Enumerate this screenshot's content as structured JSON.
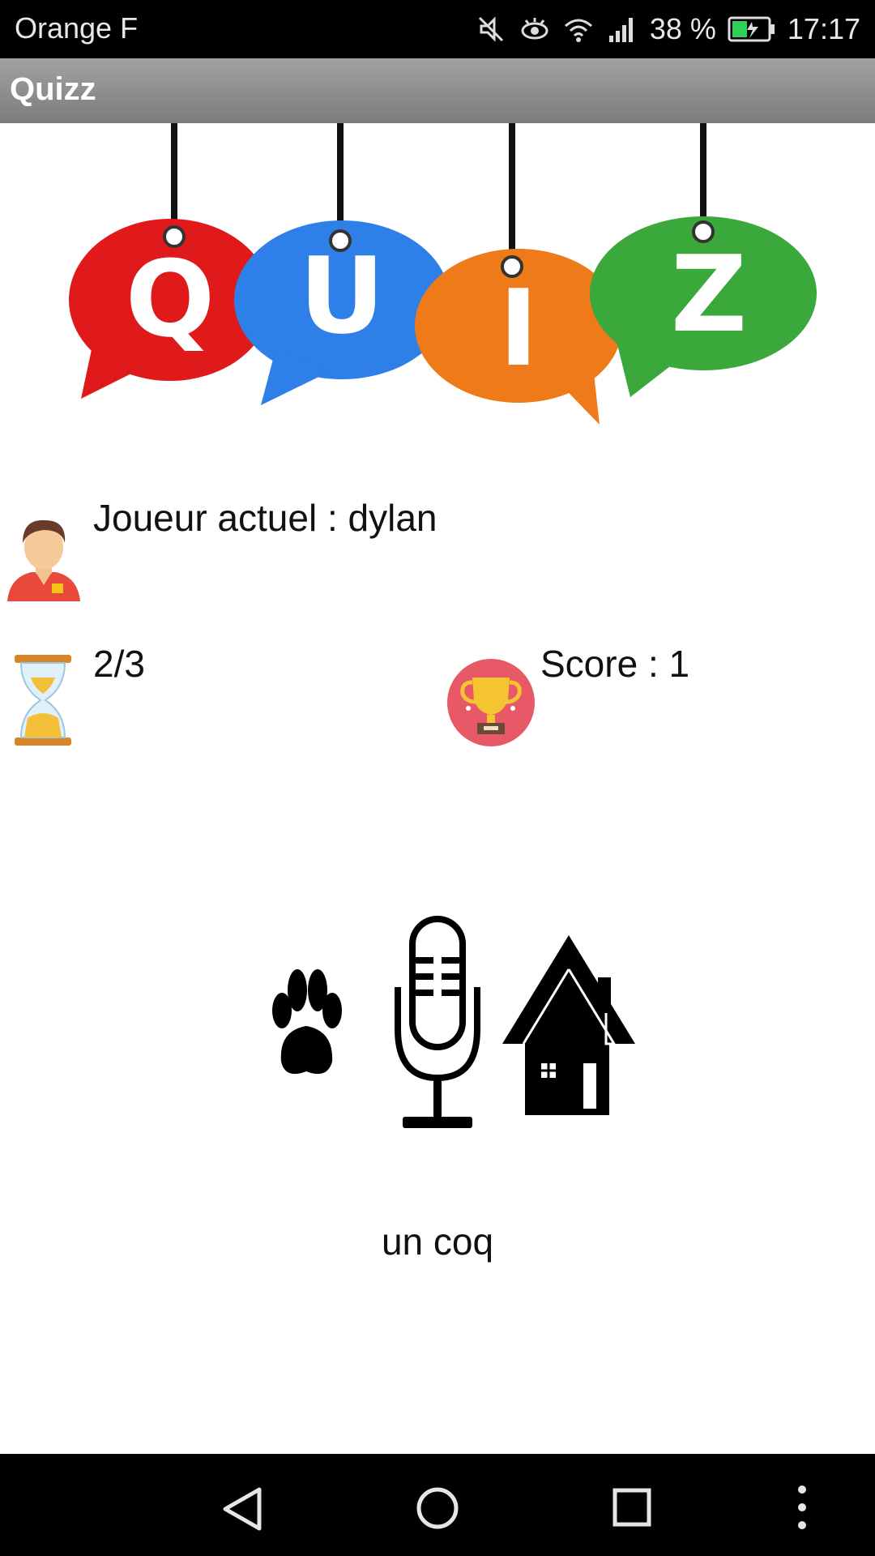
{
  "status_bar": {
    "carrier": "Orange F",
    "battery_percent": "38 %",
    "time": "17:17",
    "icons": [
      "mute-icon",
      "eye-icon",
      "wifi-icon",
      "signal-icon",
      "battery-icon"
    ]
  },
  "app": {
    "title": "Quizz"
  },
  "banner": {
    "letters": [
      "Q",
      "U",
      "I",
      "Z"
    ],
    "colors": [
      "#e01a1a",
      "#2f7fe8",
      "#ee7a1a",
      "#3aa83a"
    ]
  },
  "game": {
    "player_label": "Joueur actuel : dylan",
    "progress_label": "2/3",
    "score_label": "Score : 1"
  },
  "question": {
    "icons": [
      "paw-icon",
      "microphone-icon",
      "house-icon"
    ],
    "answer": "un coq"
  },
  "navigation": {
    "buttons": [
      "back-button",
      "home-button",
      "recents-button",
      "more-button"
    ]
  }
}
